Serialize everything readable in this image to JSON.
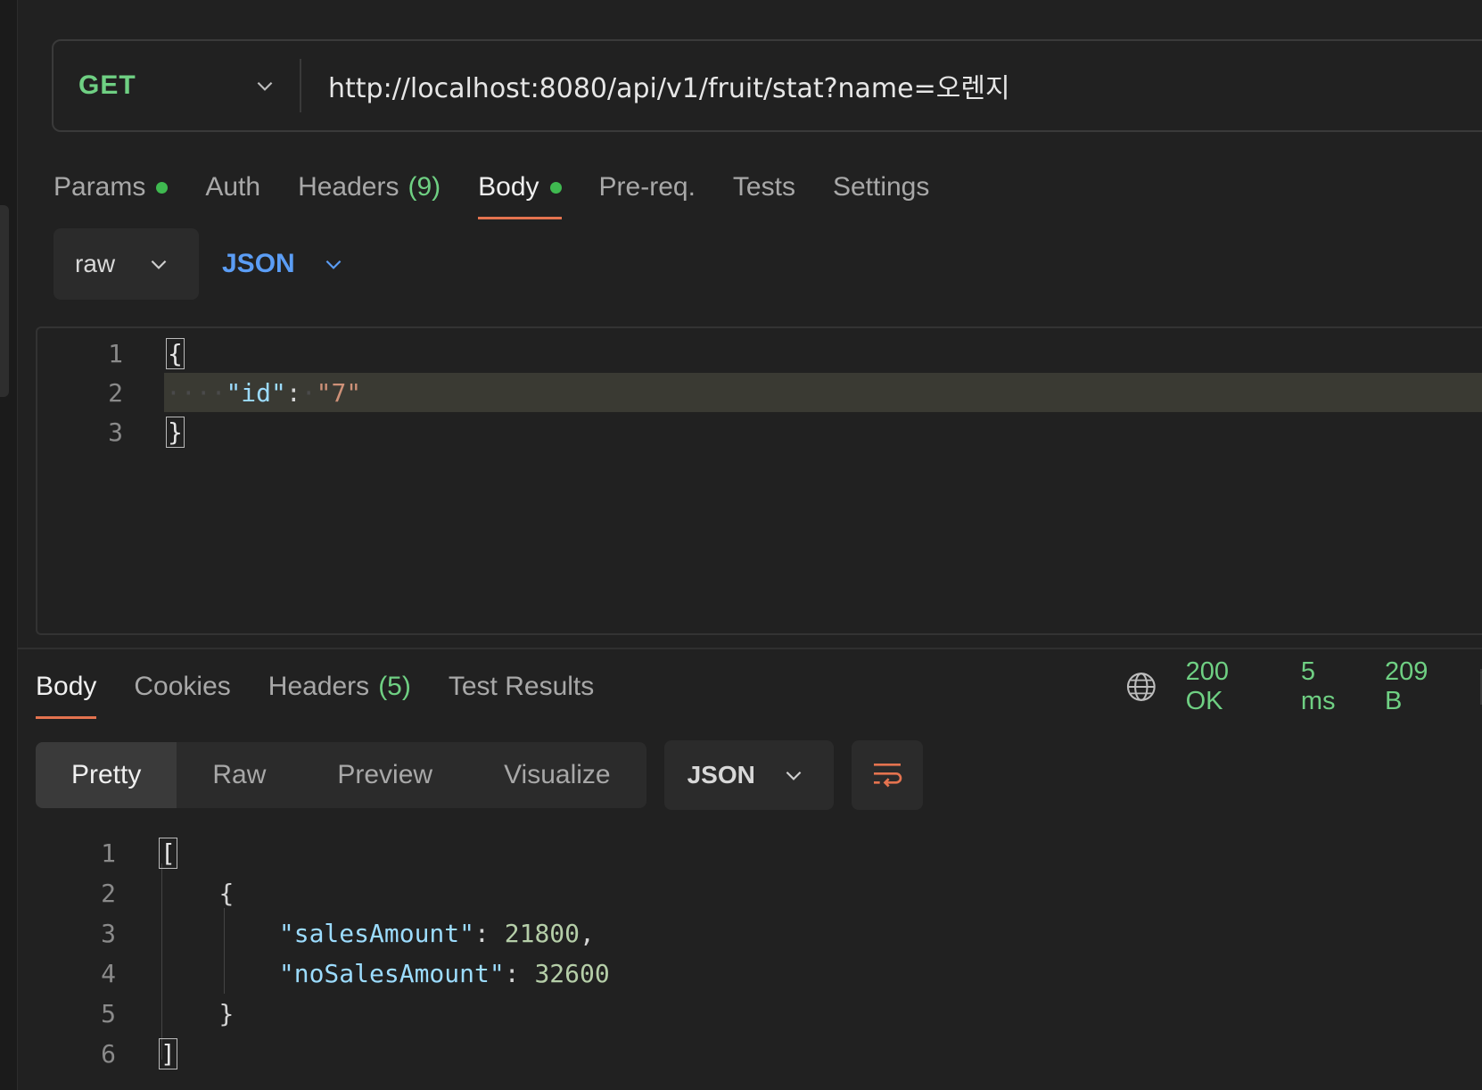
{
  "request": {
    "method": "GET",
    "url": "http://localhost:8080/api/v1/fruit/stat?name=오렌지",
    "tabs": [
      {
        "label": "Params",
        "dot": true
      },
      {
        "label": "Auth"
      },
      {
        "label": "Headers",
        "count": "(9)"
      },
      {
        "label": "Body",
        "dot": true,
        "active": true
      },
      {
        "label": "Pre-req."
      },
      {
        "label": "Tests"
      },
      {
        "label": "Settings"
      }
    ],
    "body_mode": "raw",
    "body_language": "JSON",
    "editor": {
      "lines": [
        "1",
        "2",
        "3"
      ],
      "open_brace": "{",
      "key": "\"id\"",
      "colon": ":",
      "value": "\"7\"",
      "close_brace": "}"
    }
  },
  "response": {
    "tabs": [
      {
        "label": "Body",
        "active": true
      },
      {
        "label": "Cookies"
      },
      {
        "label": "Headers",
        "count": "(5)"
      },
      {
        "label": "Test Results"
      }
    ],
    "status": "200 OK",
    "time": "5 ms",
    "size": "209 B",
    "views": [
      "Pretty",
      "Raw",
      "Preview",
      "Visualize"
    ],
    "active_view": "Pretty",
    "format": "JSON",
    "editor": {
      "lines": [
        "1",
        "2",
        "3",
        "4",
        "5",
        "6"
      ],
      "open_bracket": "[",
      "open_brace": "{",
      "key1": "\"salesAmount\"",
      "value1": "21800",
      "key2": "\"noSalesAmount\"",
      "value2": "32600",
      "close_brace": "}",
      "close_bracket": "]"
    }
  },
  "colors": {
    "accent": "#e4734f",
    "method_green": "#6fd083",
    "json_blue": "#5b9df5",
    "status_green": "#6fd083"
  }
}
